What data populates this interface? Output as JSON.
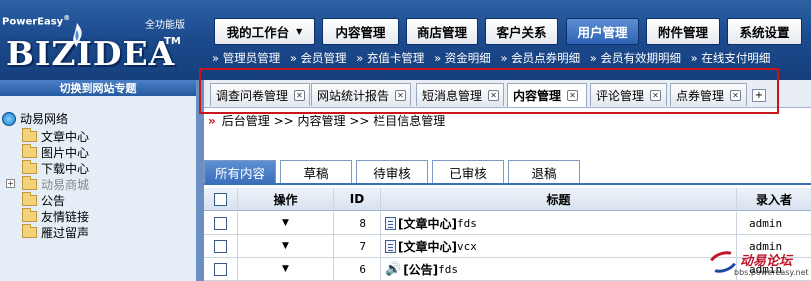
{
  "brand": {
    "powered_by": "PowerEasy",
    "registered": "®",
    "edition": "全功能版",
    "logo": "BIZIDEA",
    "tm": "TM"
  },
  "main_nav": [
    {
      "label": "我的工作台",
      "dropdown": true
    },
    {
      "label": "内容管理"
    },
    {
      "label": "商店管理"
    },
    {
      "label": "客户关系"
    },
    {
      "label": "用户管理",
      "active": true
    },
    {
      "label": "附件管理"
    },
    {
      "label": "系统设置"
    }
  ],
  "sub_nav": [
    "» 管理员管理",
    "» 会员管理",
    "» 充值卡管理",
    "» 资金明细",
    "» 会员点券明细",
    "» 会员有效期明细",
    "» 在线支付明细"
  ],
  "sidebar": {
    "switch_label": "切换到网站专题",
    "root": "动易网络",
    "items": [
      {
        "label": "文章中心"
      },
      {
        "label": "图片中心"
      },
      {
        "label": "下载中心"
      },
      {
        "label": "动易商城",
        "disabled": true,
        "expandable": true
      },
      {
        "label": "公告"
      },
      {
        "label": "友情链接"
      },
      {
        "label": "雁过留声"
      }
    ]
  },
  "tabs": [
    {
      "label": "调查问卷管理"
    },
    {
      "label": "网站统计报告"
    },
    {
      "label": "短消息管理"
    },
    {
      "label": "内容管理",
      "active": true
    },
    {
      "label": "评论管理"
    },
    {
      "label": "点券管理"
    }
  ],
  "tab_close_glyph": "✕",
  "tab_add_glyph": "+",
  "breadcrumb": {
    "mark": "»",
    "text": "后台管理 >> 内容管理 >> 栏目信息管理"
  },
  "status_tabs": [
    {
      "label": "所有内容",
      "active": true
    },
    {
      "label": "草稿"
    },
    {
      "label": "待审核"
    },
    {
      "label": "已审核"
    },
    {
      "label": "退稿"
    }
  ],
  "table": {
    "headers": {
      "op": "操作",
      "id": "ID",
      "title": "标题",
      "author": "录入者"
    },
    "rows": [
      {
        "id": "8",
        "category": "[文章中心]",
        "title": "fds",
        "author": "admin",
        "icon": "doc"
      },
      {
        "id": "7",
        "category": "[文章中心]",
        "title": "vcx",
        "author": "admin",
        "icon": "doc"
      },
      {
        "id": "6",
        "category": "[公告]",
        "title": "fds",
        "author": "admin",
        "icon": "speaker"
      }
    ]
  },
  "watermark": {
    "text": "动易论坛",
    "url": "bbs.powereasy.net"
  },
  "colors": {
    "header": "#1c4b8e",
    "highlight": "#c8161d",
    "active_tab": "#3a6fbd"
  }
}
